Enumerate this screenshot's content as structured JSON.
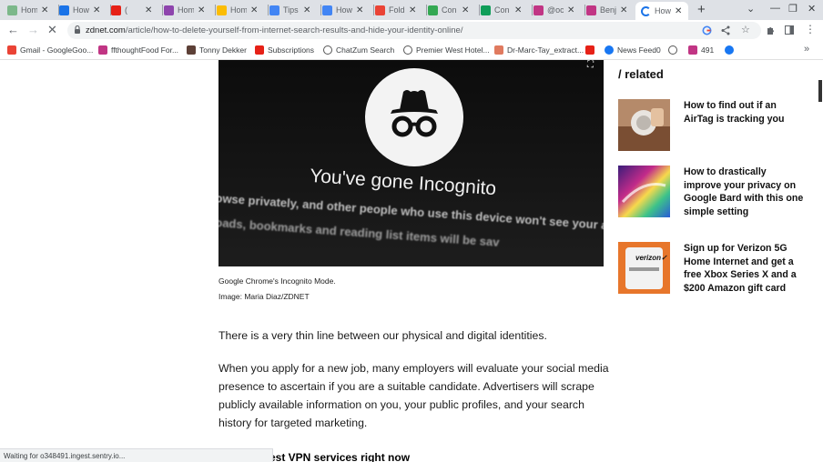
{
  "tabs": [
    {
      "title": "Hom",
      "icon": "sheet-icon",
      "color": "#7cb88a"
    },
    {
      "title": "How",
      "icon": "ct-icon",
      "color": "#1a73e8"
    },
    {
      "title": "(",
      "icon": "youtube-icon",
      "color": "#e62117"
    },
    {
      "title": "Hom",
      "icon": "site-icon",
      "color": "#8e44ad"
    },
    {
      "title": "Hom",
      "icon": "drive-icon",
      "color": "#fbbc04"
    },
    {
      "title": "Tips",
      "icon": "docs-icon",
      "color": "#4285f4"
    },
    {
      "title": "How",
      "icon": "docs-icon",
      "color": "#4285f4"
    },
    {
      "title": "Fold",
      "icon": "gmail-icon",
      "color": "#ea4335"
    },
    {
      "title": "Con",
      "icon": "drive-icon",
      "color": "#34a853"
    },
    {
      "title": "Con",
      "icon": "sheets-icon",
      "color": "#0f9d58"
    },
    {
      "title": "@oc",
      "icon": "instagram-icon",
      "color": "#c13584"
    },
    {
      "title": "Benj",
      "icon": "instagram-icon",
      "color": "#c13584"
    },
    {
      "title": "How",
      "icon": "loading-icon",
      "color": "#1a73e8"
    }
  ],
  "address": {
    "host": "zdnet.com",
    "path": "/article/how-to-delete-yourself-from-internet-search-results-and-hide-your-identity-online/"
  },
  "bookmarks": [
    {
      "label": "Gmail - GoogleGoo...",
      "icon": "gmail-icon",
      "color": "#ea4335"
    },
    {
      "label": "ffthoughtFood For...",
      "icon": "instagram-icon",
      "color": "#c13584"
    },
    {
      "label": "Tonny Dekker",
      "icon": "bookmark-icon",
      "color": "#5d4037"
    },
    {
      "label": "Subscriptions",
      "icon": "youtube-icon",
      "color": "#e62117"
    },
    {
      "label": "ChatZum Search",
      "icon": "globe-icon",
      "color": "#555555"
    },
    {
      "label": "Premier West Hotel...",
      "icon": "search-icon",
      "color": "#555555"
    },
    {
      "label": "Dr-Marc-Tay_extract...",
      "icon": "swirl-icon",
      "color": "#e07a5f"
    },
    {
      "label": "",
      "icon": "youtube-icon",
      "color": "#e62117"
    },
    {
      "label": "News Feed0",
      "icon": "facebook-icon",
      "color": "#1877f2"
    },
    {
      "label": "",
      "icon": "globe-icon",
      "color": "#555555"
    },
    {
      "label": "491",
      "icon": "instagram-icon",
      "color": "#c13584"
    },
    {
      "label": "",
      "icon": "facebook-icon",
      "color": "#1877f2"
    }
  ],
  "article": {
    "hero_text": "You've gone Incognito",
    "hero_blur_1": "owse privately, and other people who use this device won't see your activ",
    "hero_blur_2": "oads, bookmarks and reading list items will be sav",
    "caption": "Google Chrome's Incognito Mode.",
    "credit": "Image: Maria Diaz/ZDNET",
    "para1": "There is a very thin line between our physical and digital identities.",
    "para2": "When you apply for a new job, many employers will evaluate your social media presence to ascertain if you are a suitable candidate. Advertisers will scrape publicly available information on you, your public profiles, and your search history for targeted marketing.",
    "subhead": "est VPN services right now"
  },
  "related": {
    "heading": "/ related",
    "items": [
      {
        "title": "How to find out if an AirTag is tracking you"
      },
      {
        "title": "How to drastically improve your privacy on Google Bard with this one simple setting"
      },
      {
        "title": "Sign up for Verizon 5G Home Internet and get a free Xbox Series X and a $200 Amazon gift card"
      }
    ],
    "verizon_logo": "verizon✓"
  },
  "status_text": "Waiting for o348491.ingest.sentry.io..."
}
